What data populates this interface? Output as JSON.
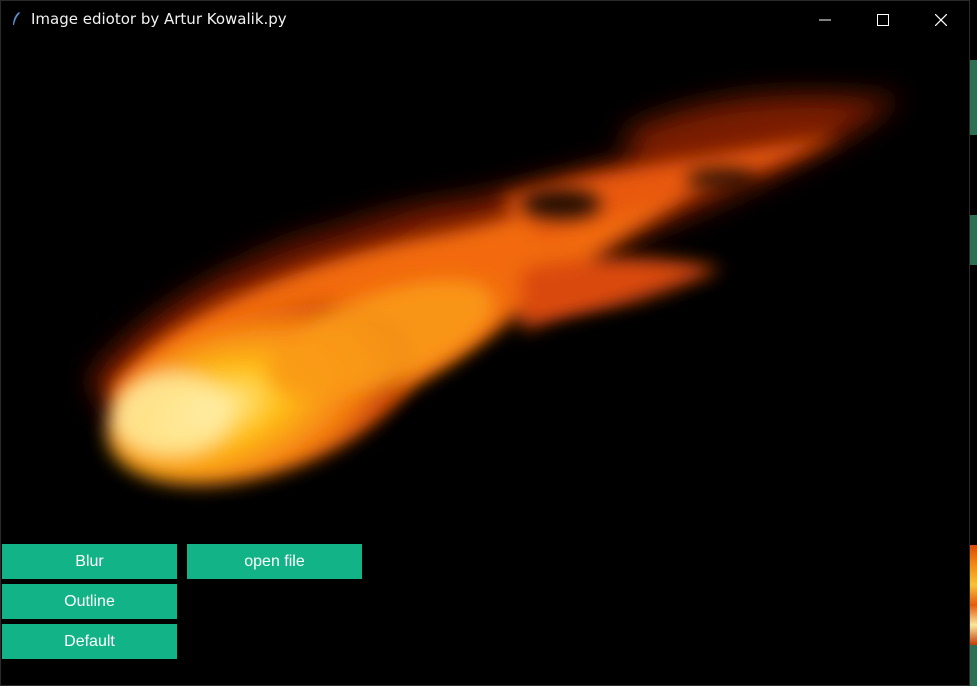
{
  "window": {
    "title": "Image ediotor by Artur Kowalik.py",
    "controls": {
      "minimize": "minimize-icon",
      "maximize": "maximize-icon",
      "close": "close-icon"
    }
  },
  "canvas": {
    "image_description_icon": "fireball-image"
  },
  "buttons": {
    "blur": "Blur",
    "open_file": "open file",
    "outline": "Outline",
    "default": "Default"
  },
  "colors": {
    "button_bg": "#12b386",
    "background": "#000000"
  }
}
